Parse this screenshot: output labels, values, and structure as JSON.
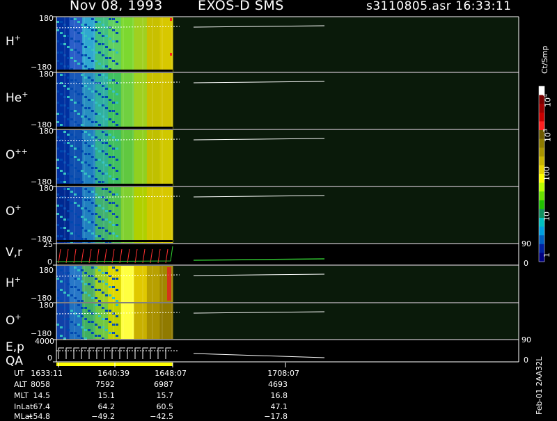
{
  "header": {
    "date": "Nov 08, 1993",
    "instrument": "EXOS-D SMS",
    "file_time": "s3110805.asr  16:33:11"
  },
  "panels": [
    {
      "label": "H",
      "sup": "+",
      "top_tick": "180",
      "bottom_tick": "−180"
    },
    {
      "label": "He",
      "sup": "+",
      "top_tick": "180",
      "bottom_tick": "−180"
    },
    {
      "label": "O",
      "sup": "++",
      "top_tick": "180",
      "bottom_tick": "−180"
    },
    {
      "label": "O",
      "sup": "+",
      "top_tick": "180",
      "bottom_tick": "−180"
    },
    {
      "label": "V,r",
      "sup": "",
      "top_tick": "25",
      "bottom_tick": "0",
      "right_top": "90",
      "right_bottom": "0"
    },
    {
      "label": "H",
      "sup": "+",
      "top_tick": "180",
      "bottom_tick": "−180"
    },
    {
      "label": "O",
      "sup": "+",
      "top_tick": "180",
      "bottom_tick": "−180"
    },
    {
      "label": "E,p",
      "sup": "",
      "top_tick": "4000",
      "bottom_tick": "0",
      "right_top": "90",
      "right_bottom": "0"
    }
  ],
  "qa_label": "QA",
  "colorbar": {
    "unit": "Ct/Smp",
    "labels": [
      "10",
      "4",
      "10",
      "3",
      "100",
      "10",
      "1"
    ],
    "colors": [
      "#ffffff",
      "#7a0000",
      "#a00000",
      "#c80000",
      "#ff2020",
      "#6e5a00",
      "#8c7a00",
      "#a89400",
      "#c8b400",
      "#e6d200",
      "#ffff00",
      "#b8ff00",
      "#68e000",
      "#20c000",
      "#109060",
      "#00c0c0",
      "#00a0e0",
      "#0060c0",
      "#0020a0",
      "#000080"
    ]
  },
  "time_table": {
    "rows": [
      {
        "name": "UT",
        "values": [
          "1633:11",
          "1640:39",
          "1648:07",
          "1708:07"
        ]
      },
      {
        "name": "ALT",
        "values": [
          "8058",
          "7592",
          "6987",
          "4693"
        ]
      },
      {
        "name": "MLT",
        "values": [
          "14.5",
          "15.1",
          "15.7",
          "16.8"
        ]
      },
      {
        "name": "InLat",
        "values": [
          "67.4",
          "64.2",
          "60.5",
          "47.1"
        ]
      },
      {
        "name": "MLat",
        "values": [
          "−54.8",
          "−49.2",
          "−42.5",
          "−17.8"
        ]
      }
    ]
  },
  "footer_tag": "Feb-01 2AA32L",
  "chart_data": {
    "type": "heatmap",
    "title": "Nov 08, 1993   EXOS-D SMS",
    "x": [
      "1633:11",
      "1640:39",
      "1648:07",
      "1708:07"
    ],
    "series": [
      {
        "name": "H+",
        "ylim": [
          -180,
          180
        ]
      },
      {
        "name": "He+",
        "ylim": [
          -180,
          180
        ]
      },
      {
        "name": "O++",
        "ylim": [
          -180,
          180
        ]
      },
      {
        "name": "O+",
        "ylim": [
          -180,
          180
        ]
      },
      {
        "name": "V,r",
        "ylim": [
          0,
          25
        ]
      },
      {
        "name": "H+",
        "ylim": [
          -180,
          180
        ]
      },
      {
        "name": "O+",
        "ylim": [
          -180,
          180
        ]
      },
      {
        "name": "E,p",
        "ylim": [
          0,
          4000
        ]
      }
    ],
    "colorbar_range": [
      1,
      10000
    ],
    "colorbar_unit": "Ct/Smp"
  }
}
